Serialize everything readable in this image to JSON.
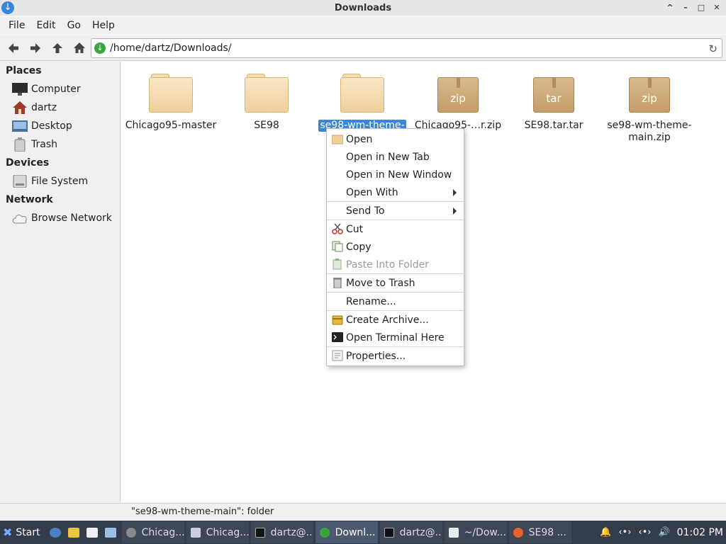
{
  "window": {
    "title": "Downloads"
  },
  "menubar": {
    "items": [
      "File",
      "Edit",
      "Go",
      "Help"
    ]
  },
  "toolbar": {
    "path": "/home/dartz/Downloads/"
  },
  "sidebar": {
    "places_heading": "Places",
    "places": [
      "Computer",
      "dartz",
      "Desktop",
      "Trash"
    ],
    "devices_heading": "Devices",
    "devices": [
      "File System"
    ],
    "network_heading": "Network",
    "network": [
      "Browse Network"
    ]
  },
  "files": [
    {
      "name": "Chicago95-master",
      "type": "folder",
      "badge": ""
    },
    {
      "name": "SE98",
      "type": "folder",
      "badge": ""
    },
    {
      "name": "se98-wm-theme-",
      "type": "folder",
      "badge": "",
      "selected": true
    },
    {
      "name": "Chicago95-…r.zip",
      "type": "archive",
      "badge": "zip"
    },
    {
      "name": "SE98.tar.tar",
      "type": "archive",
      "badge": "tar"
    },
    {
      "name": "se98-wm-theme-main.zip",
      "type": "archive",
      "badge": "zip"
    }
  ],
  "context_menu": {
    "open": "Open",
    "open_new_tab": "Open in New Tab",
    "open_new_window": "Open in New Window",
    "open_with": "Open With",
    "send_to": "Send To",
    "cut": "Cut",
    "copy": "Copy",
    "paste_into_folder": "Paste Into Folder",
    "move_to_trash": "Move to Trash",
    "rename": "Rename...",
    "create_archive": "Create Archive...",
    "open_terminal": "Open Terminal Here",
    "properties": "Properties..."
  },
  "status": {
    "text": "\"se98-wm-theme-main\": folder"
  },
  "taskbar": {
    "start": "Start",
    "tasks": [
      {
        "label": "Chicag...",
        "icon": "gear-icon",
        "active": false
      },
      {
        "label": "Chicag...",
        "icon": "window-icon",
        "active": false
      },
      {
        "label": "dartz@...",
        "icon": "terminal-icon",
        "active": false
      },
      {
        "label": "Downl...",
        "icon": "download-icon",
        "active": true
      },
      {
        "label": "dartz@...",
        "icon": "terminal-icon",
        "active": false
      },
      {
        "label": "~/Dow...",
        "icon": "editor-icon",
        "active": false
      },
      {
        "label": "SE98 ...",
        "icon": "firefox-icon",
        "active": false
      }
    ],
    "clock": "01:02 PM"
  },
  "colors": {
    "accent": "#3a86d6",
    "taskbar": "#333c4a"
  }
}
